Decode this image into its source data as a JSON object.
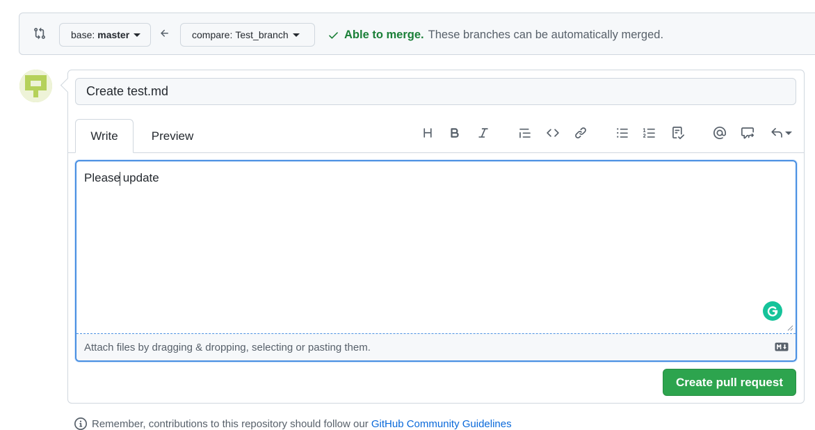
{
  "compare": {
    "base_prefix": "base:",
    "base_branch": "master",
    "compare_prefix": "compare:",
    "compare_branch": "Test_branch",
    "merge_ok": "Able to merge.",
    "merge_desc": "These branches can be automatically merged."
  },
  "form": {
    "title_value": "Create test.md",
    "tabs": [
      "Write",
      "Preview"
    ],
    "body_before_caret": "Please",
    "body_after_caret": " update",
    "attach_hint": "Attach files by dragging & dropping, selecting or pasting them."
  },
  "toolbar": {
    "icons": [
      "heading-icon",
      "bold-icon",
      "italic-icon",
      "quote-icon",
      "code-icon",
      "link-icon",
      "unordered-list-icon",
      "ordered-list-icon",
      "task-list-icon",
      "mention-icon",
      "reference-icon",
      "reply-icon"
    ]
  },
  "submit": {
    "label": "Create pull request"
  },
  "footer": {
    "text": "Remember, contributions to this repository should follow our",
    "link": "GitHub Community Guidelines"
  },
  "colors": {
    "success": "#1a7f37",
    "primary_button": "#2da44e",
    "focus_border": "#4a90e2",
    "grammarly": "#15c39a"
  }
}
